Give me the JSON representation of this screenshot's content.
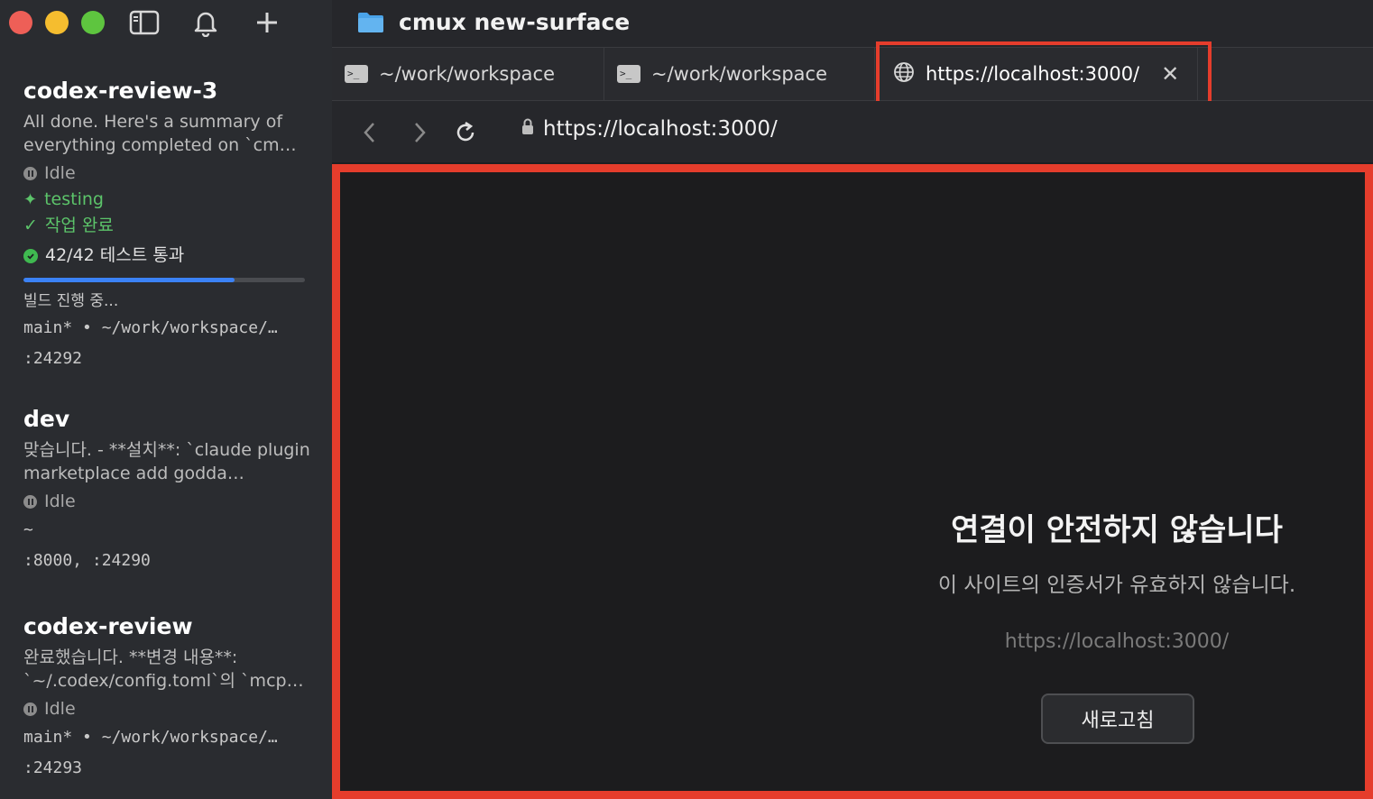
{
  "window": {
    "title": "cmux new-surface"
  },
  "sidebar": {
    "workspaces": [
      {
        "name": "codex-review-3",
        "description": "All done. Here's a summary of everything completed on `cm…",
        "status": "Idle",
        "tag": "testing",
        "done": "작업 완료",
        "tests": "42/42 테스트 통과",
        "progress": 0.75,
        "build": "빌드 진행 중...",
        "branch": "main* • ~/work/workspace/…",
        "ports": ":24292"
      },
      {
        "name": "dev",
        "description": "맞습니다. - **설치**: `claude plugin marketplace add godda…",
        "status": "Idle",
        "path": "~",
        "ports": ":8000, :24290"
      },
      {
        "name": "codex-review",
        "description": "완료했습니다. **변경 내용**: `~/.codex/config.toml`의 `mcp…",
        "status": "Idle",
        "branch": "main* • ~/work/workspace/…",
        "ports": ":24293"
      }
    ]
  },
  "tabs": [
    {
      "label": "~/work/workspace",
      "icon": "terminal-icon"
    },
    {
      "label": "~/work/workspace",
      "icon": "terminal-icon"
    },
    {
      "label": "https://localhost:3000/",
      "icon": "globe-icon",
      "active": true
    }
  ],
  "navbar": {
    "url": "https://localhost:3000/"
  },
  "error_page": {
    "title": "연결이 안전하지 않습니다",
    "subtitle": "이 사이트의 인증서가 유효하지 않습니다.",
    "url": "https://localhost:3000/",
    "reload_label": "새로고침"
  },
  "colors": {
    "highlight": "#e53d2c",
    "progress": "#3b82f6",
    "success": "#3fb950"
  }
}
